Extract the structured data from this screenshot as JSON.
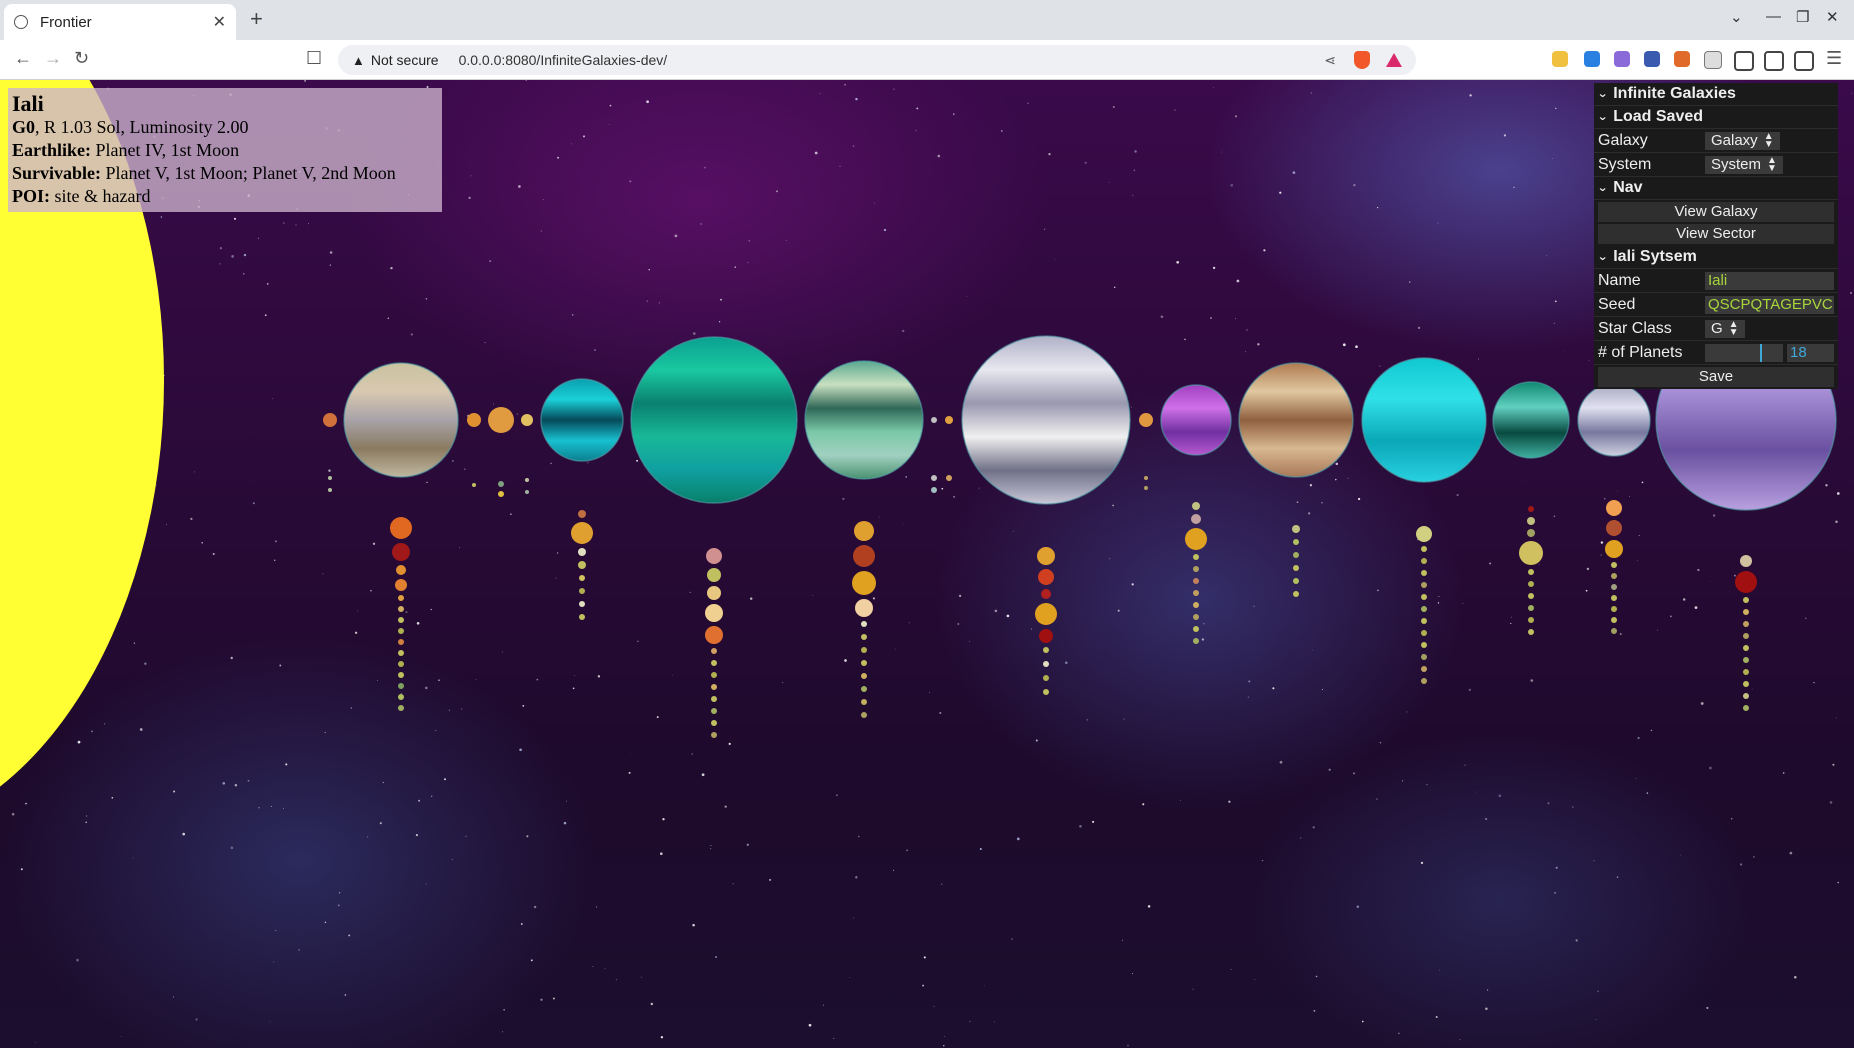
{
  "browser": {
    "tab_title": "Frontier",
    "tab_close": "✕",
    "new_tab": "+",
    "security_label": "Not secure",
    "url": "0.0.0.0:8080/InfiniteGalaxies-dev/",
    "icons": [
      "back-icon",
      "forward-icon",
      "reload-icon",
      "bookmark-icon",
      "share-icon",
      "brave-shields-icon",
      "brave-rewards-icon"
    ]
  },
  "info": {
    "system_name": "Iali",
    "class_label": "G0",
    "class_rest": ", R 1.03 Sol, Luminosity 2.00",
    "earthlike_label": "Earthlike:",
    "earthlike_value": " Planet IV, 1st Moon",
    "survivable_label": "Survivable:",
    "survivable_value": " Planet V, 1st Moon; Planet V, 2nd Moon",
    "poi_label": "POI:",
    "poi_value": " site & hazard"
  },
  "panel": {
    "root_title": "Infinite Galaxies",
    "load_saved": {
      "title": "Load Saved",
      "galaxy_label": "Galaxy",
      "galaxy_value": "Galaxy",
      "system_label": "System",
      "system_value": "System"
    },
    "nav": {
      "title": "Nav",
      "view_galaxy": "View Galaxy",
      "view_sector": "View Sector"
    },
    "system": {
      "title": "Iali Sytsem",
      "name_label": "Name",
      "name_value": "Iali",
      "seed_label": "Seed",
      "seed_value": "QSCPQTAGEPVC",
      "star_class_label": "Star Class",
      "star_class_value": "G",
      "planets_label": "# of Planets",
      "planets_value": "18",
      "planets_level": 0.72,
      "save_label": "Save"
    }
  },
  "colors": {
    "sun": "#ffff33",
    "panel_bg": "#1a1a1a",
    "text_field": "#a8d63a",
    "number_field": "#3ea8d8"
  }
}
